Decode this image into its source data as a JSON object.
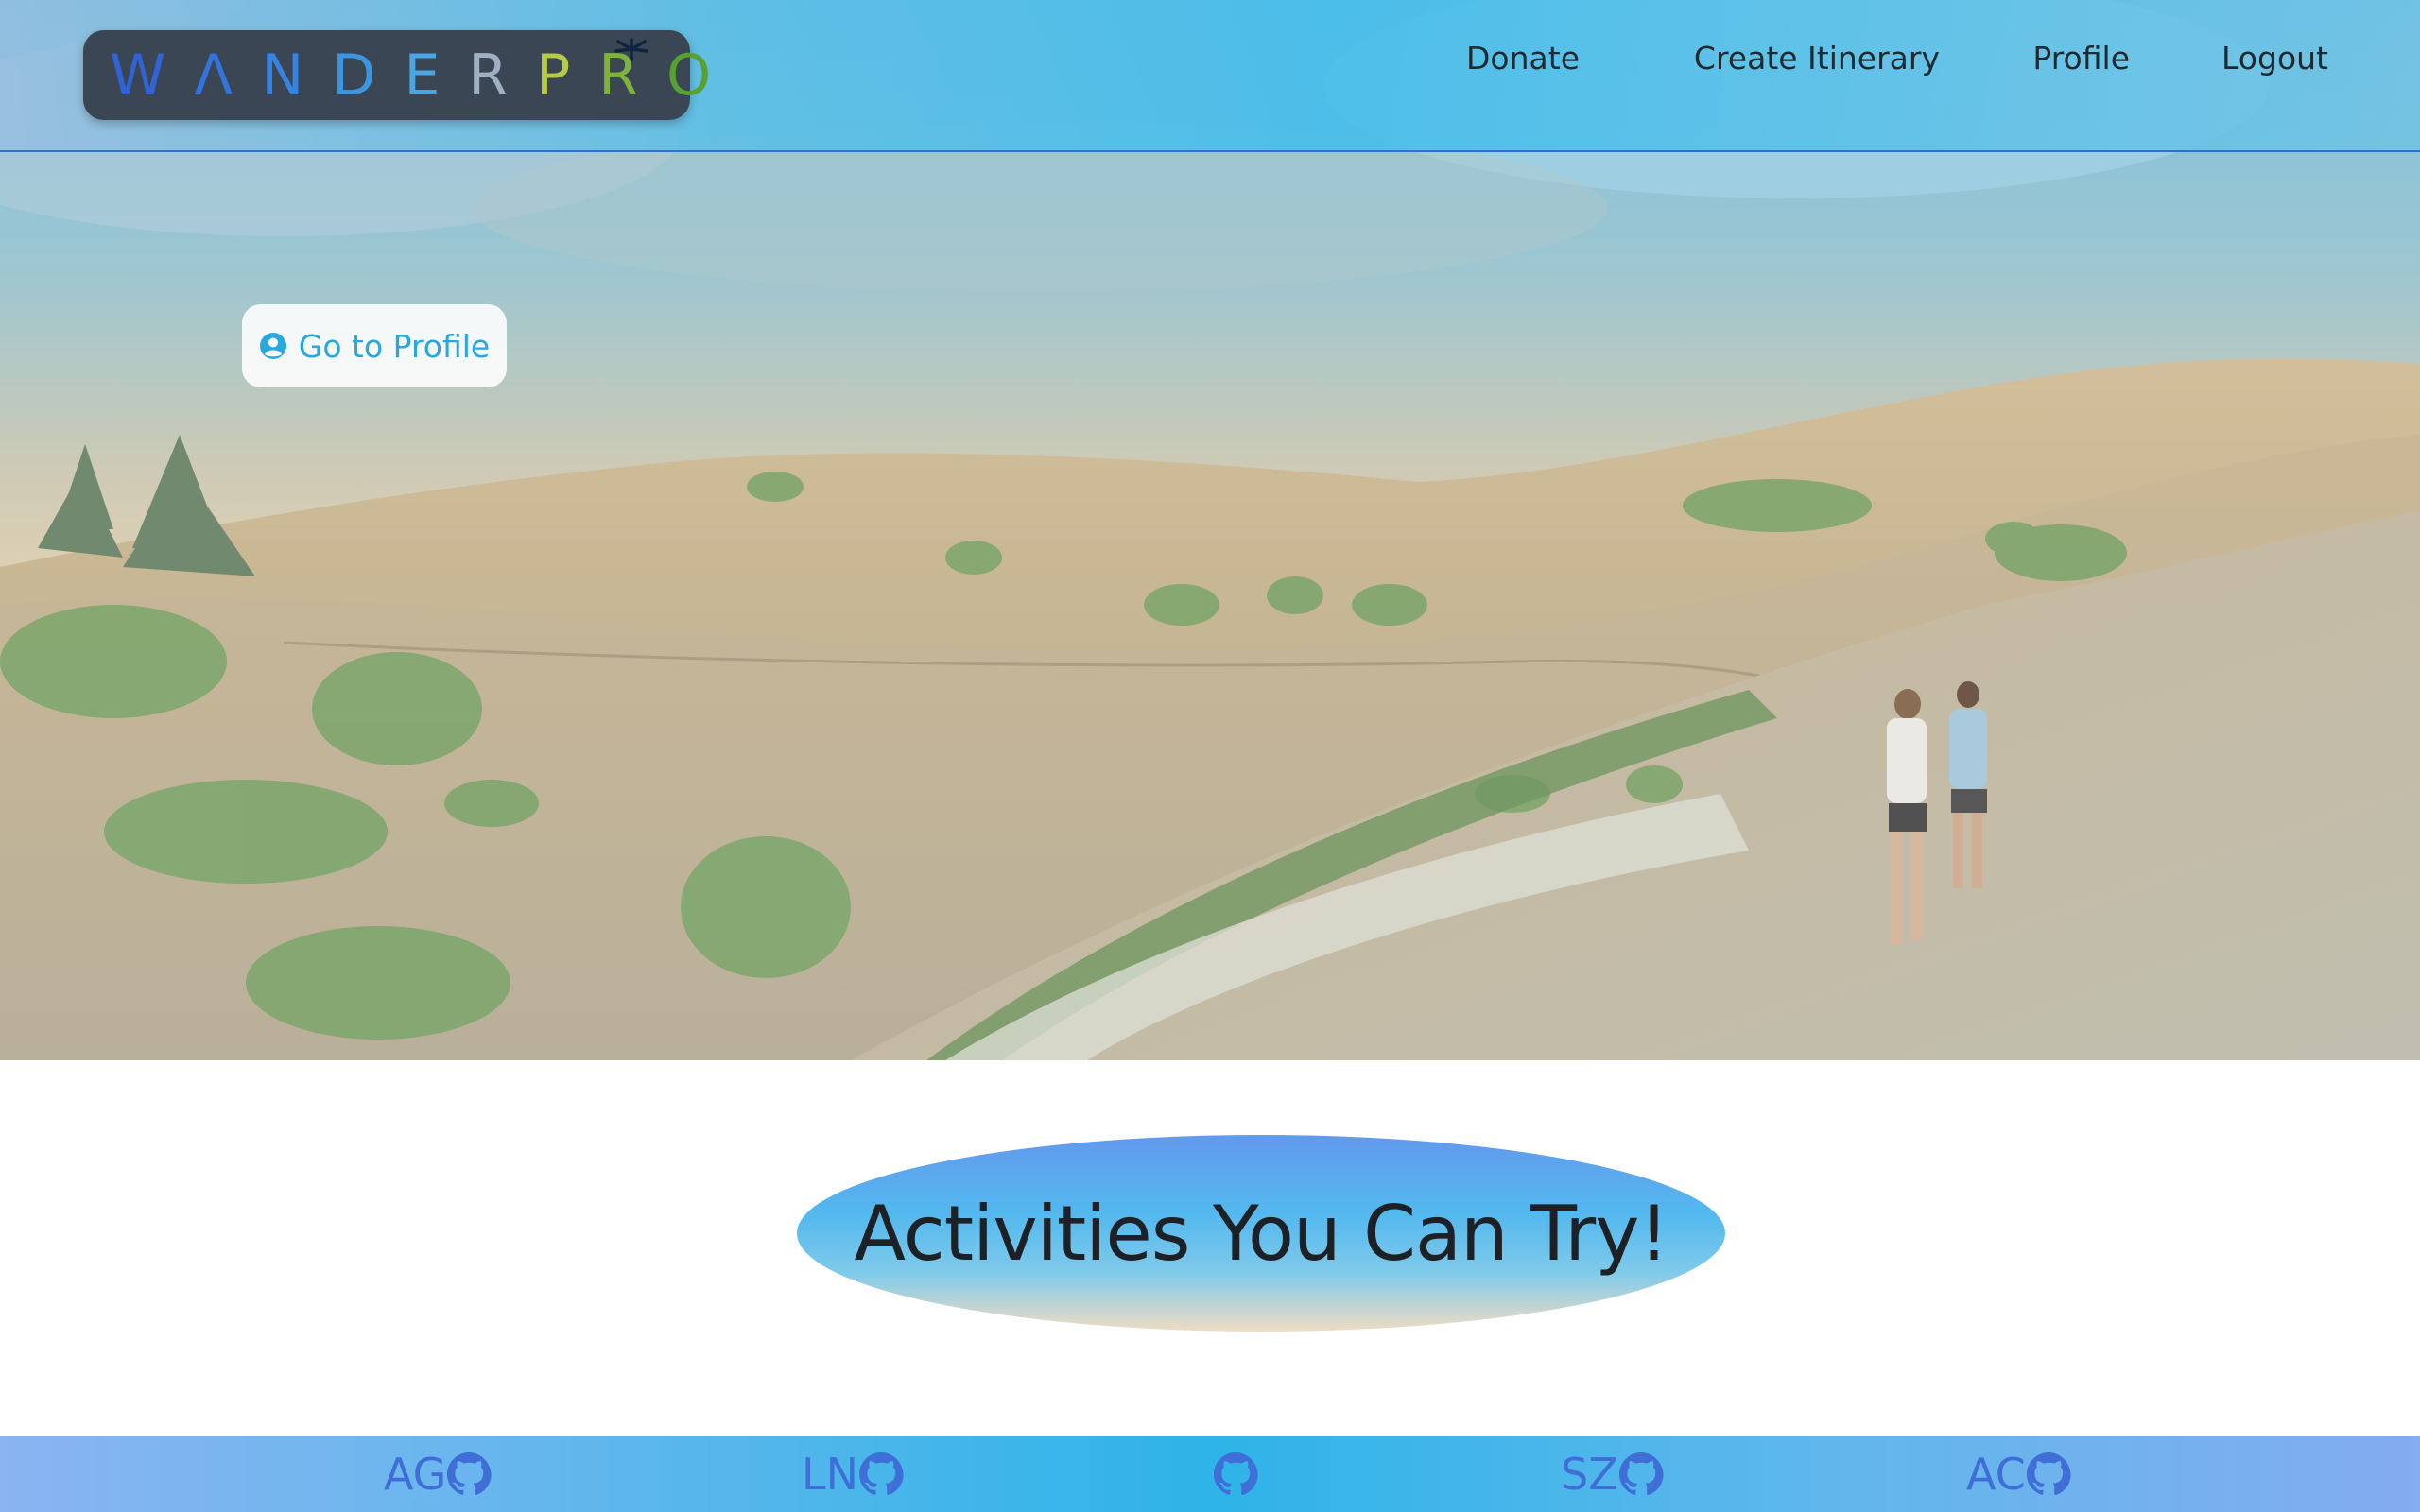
{
  "header": {
    "logo_text": "WANDERPRO",
    "logo_letters": [
      "W",
      "Λ",
      "N",
      "D",
      "E",
      "R",
      "P",
      "R",
      "O"
    ],
    "nav": [
      {
        "label": "Donate"
      },
      {
        "label": "Create Itinerary"
      },
      {
        "label": "Profile"
      },
      {
        "label": "Logout"
      }
    ]
  },
  "hero": {
    "profile_button_label": "Go to Profile",
    "profile_icon": "user-circle-icon"
  },
  "activities": {
    "title": "Activities You Can Try!"
  },
  "footer": {
    "links": [
      {
        "label": "AG",
        "icon": "github-icon"
      },
      {
        "label": "LN",
        "icon": "github-icon"
      },
      {
        "label": "",
        "icon": "github-icon"
      },
      {
        "label": "SZ",
        "icon": "github-icon"
      },
      {
        "label": "AC",
        "icon": "github-icon"
      }
    ]
  },
  "colors": {
    "logo_bg": "#3a4654",
    "nav_border": "#2f6fd8",
    "profile_text": "#2aa7dd",
    "footer_text": "#3f6fd6"
  }
}
